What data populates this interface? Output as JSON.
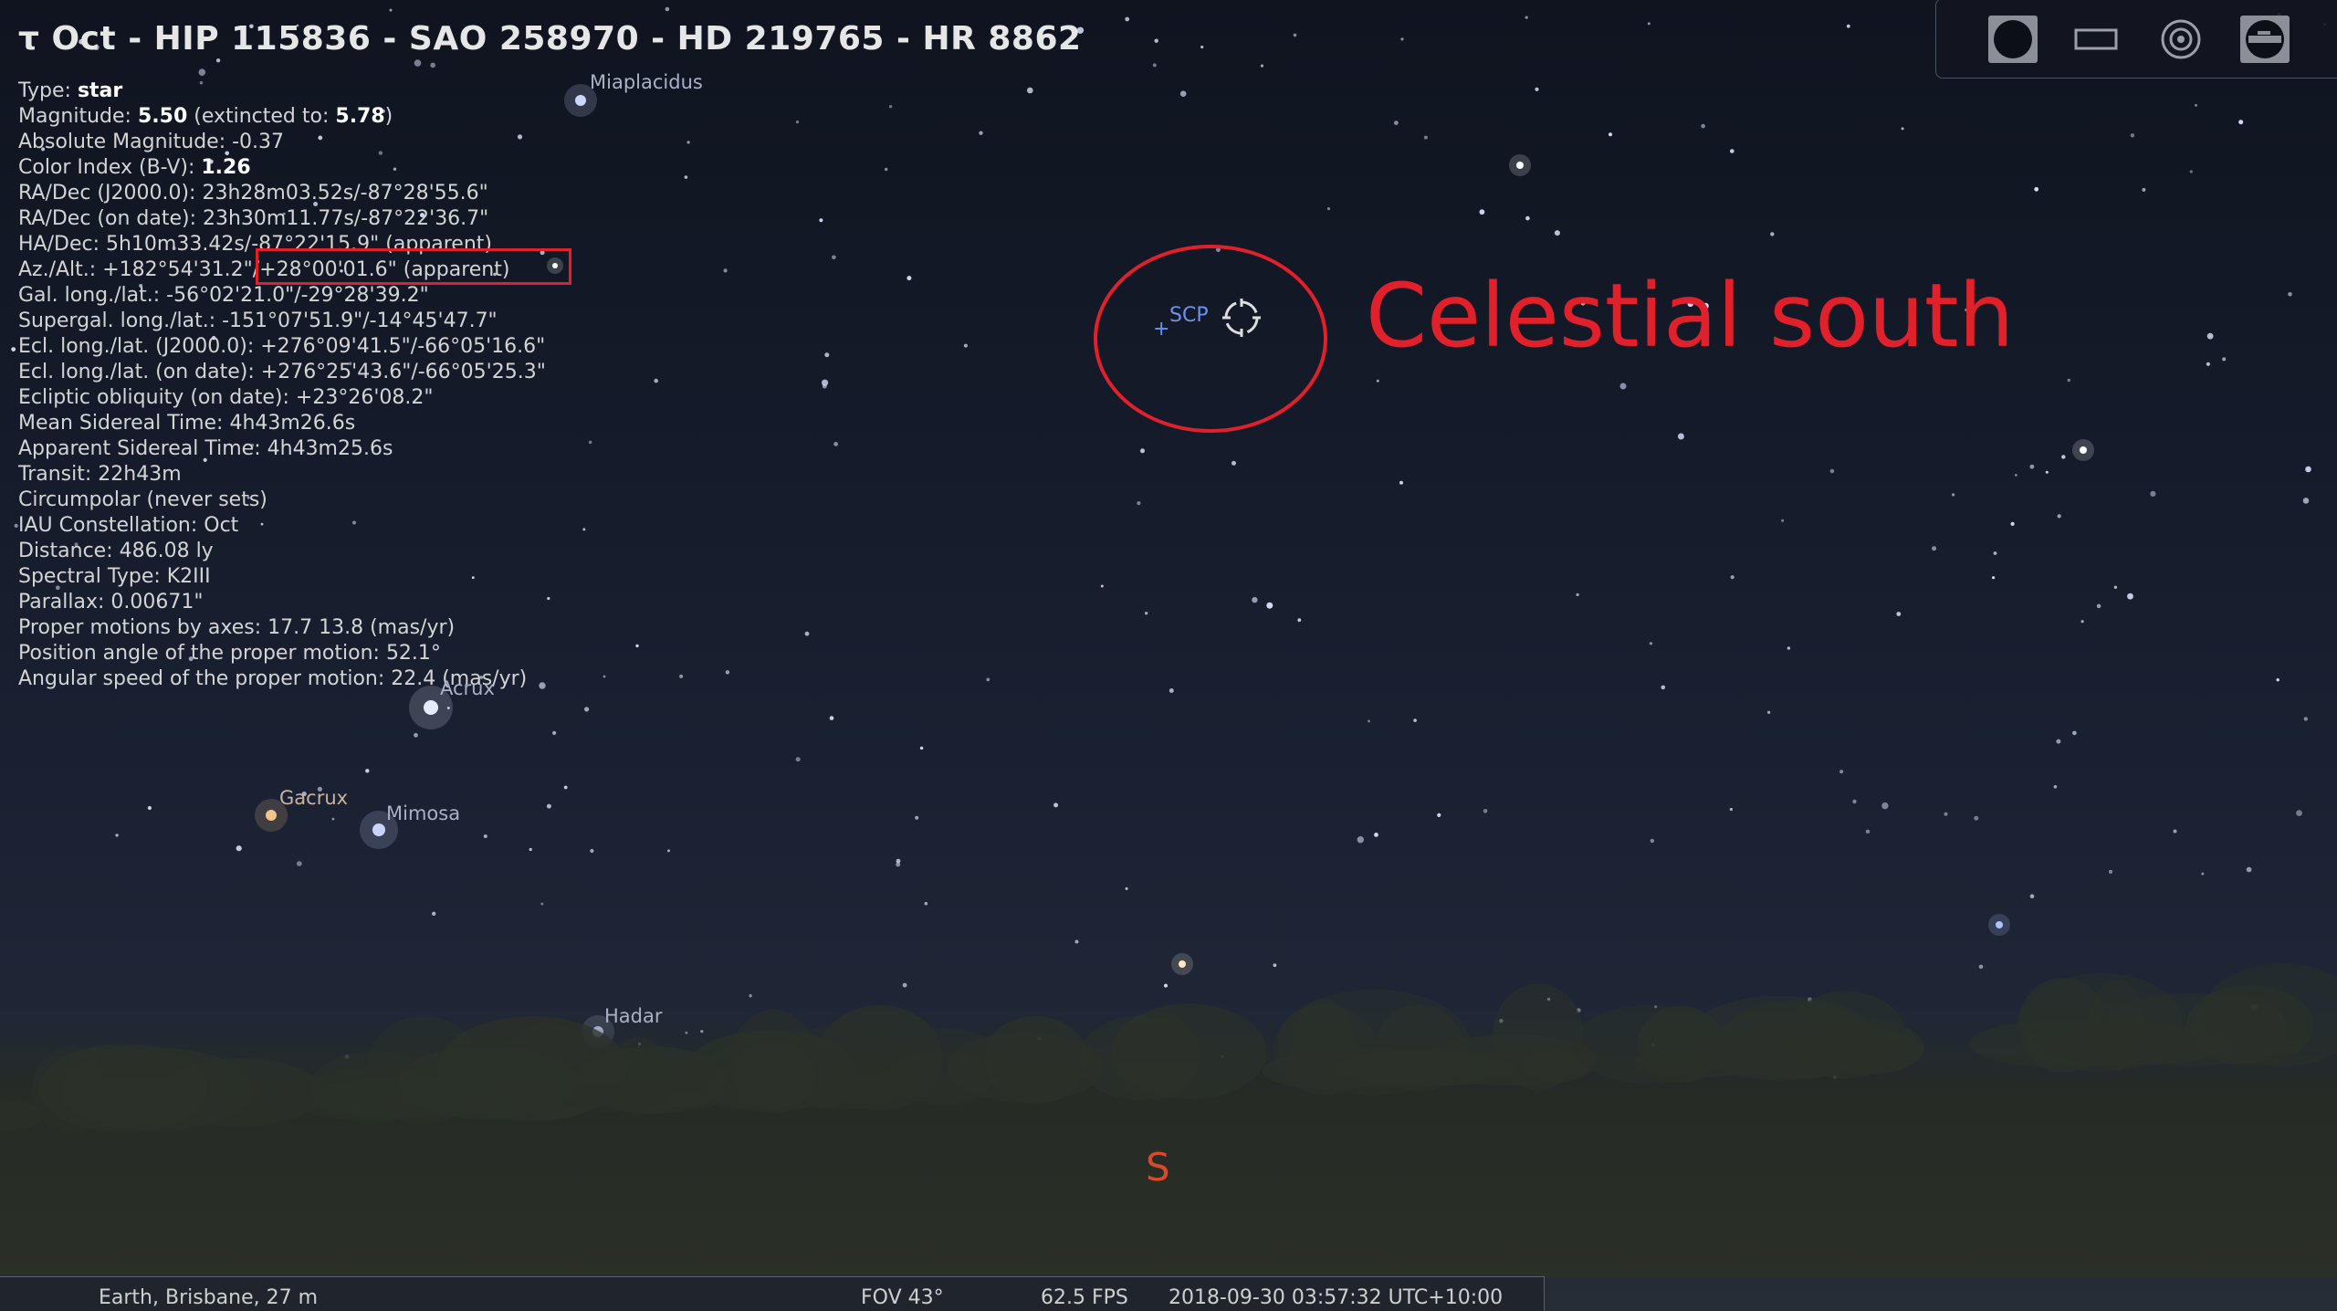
{
  "object": {
    "title": "τ Oct - HIP 115836 - SAO 258970 - HD 219765 - HR 8862",
    "info_rows": [
      {
        "label": "Type: ",
        "value": "star"
      },
      {
        "label": "Magnitude: ",
        "value": "5.50",
        "suffix": " (extincted to: ",
        "value2": "5.78",
        "suffix2": ")"
      },
      {
        "label": "Absolute Magnitude: -0.37"
      },
      {
        "label": "Color Index (B-V): ",
        "value": "1.26"
      },
      {
        "label": "RA/Dec (J2000.0): 23h28m03.52s/-87°28'55.6\""
      },
      {
        "label": "RA/Dec (on date): 23h30m11.77s/-87°22'36.7\""
      },
      {
        "label": "HA/Dec: 5h10m33.42s/-87°22'15.9\" (apparent)"
      },
      {
        "label": "Az./Alt.: +182°54'31.2\"/+28°00'01.6\" (apparent)"
      },
      {
        "label": "Gal. long./lat.: -56°02'21.0\"/-29°28'39.2\""
      },
      {
        "label": "Supergal. long./lat.: -151°07'51.9\"/-14°45'47.7\""
      },
      {
        "label": "Ecl. long./lat. (J2000.0): +276°09'41.5\"/-66°05'16.6\""
      },
      {
        "label": "Ecl. long./lat. (on date): +276°25'43.6\"/-66°05'25.3\""
      },
      {
        "label": "Ecliptic obliquity (on date): +23°26'08.2\""
      },
      {
        "label": "Mean Sidereal Time: 4h43m26.6s"
      },
      {
        "label": "Apparent Sidereal Time: 4h43m25.6s"
      },
      {
        "label": "Transit: 22h43m"
      },
      {
        "label": "Circumpolar (never sets)"
      },
      {
        "label": "IAU Constellation: Oct"
      },
      {
        "label": "Distance: 486.08 ly"
      },
      {
        "label": "Spectral Type: K2III"
      },
      {
        "label": "Parallax: 0.00671\""
      },
      {
        "label": "Proper motions by axes: 17.7 13.8 (mas/yr)"
      },
      {
        "label": "Position angle of the proper motion: 52.1°"
      },
      {
        "label": "Angular speed of the proper motion: 22.4 (mas/yr)"
      }
    ]
  },
  "annotation": {
    "text": "Celestial south",
    "color": "#e0202a"
  },
  "sky_labels": {
    "miaplacidus": "Miaplacidus",
    "acrux": "Acrux",
    "gacrux": "Gacrux",
    "mimosa": "Mimosa",
    "hadar": "Hadar",
    "scp": "SCP",
    "scp_marker": "+",
    "cardinal_south": "S"
  },
  "toolbar": {
    "buttons": [
      "moon-icon",
      "rectangle-icon",
      "target-icon",
      "telescope-icon"
    ]
  },
  "status": {
    "location": "Earth, Brisbane, 27 m",
    "fov": "FOV 43°",
    "fps": "62.5 FPS",
    "datetime": "2018-09-30 03:57:32 UTC+10:00"
  },
  "colors": {
    "highlight": "#e0202a",
    "scp": "#6f92e6",
    "cardinal": "#d84a28"
  }
}
